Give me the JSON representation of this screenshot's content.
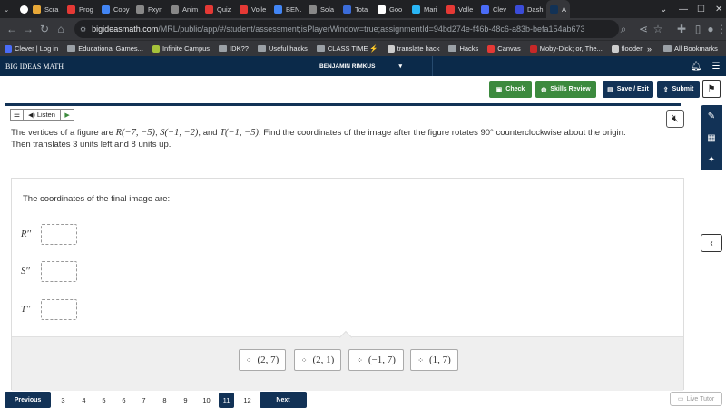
{
  "browser": {
    "tabs": [
      {
        "label": "Scra",
        "color": "#e8a838"
      },
      {
        "label": "Prog",
        "color": "#e53935"
      },
      {
        "label": "Copy",
        "color": "#4285f4"
      },
      {
        "label": "Fxyn",
        "color": "#888888"
      },
      {
        "label": "Anim",
        "color": "#888888"
      },
      {
        "label": "Quiz",
        "color": "#e53935"
      },
      {
        "label": "Volle",
        "color": "#e53935"
      },
      {
        "label": "BEN.",
        "color": "#4285f4"
      },
      {
        "label": "Sola",
        "color": "#888888"
      },
      {
        "label": "Tota",
        "color": "#3b6cd9"
      },
      {
        "label": "Goo",
        "color": "#ffffff"
      },
      {
        "label": "Mari",
        "color": "#29b6f6"
      },
      {
        "label": "Volle",
        "color": "#e53935"
      },
      {
        "label": "Clev",
        "color": "#4a6cf7"
      },
      {
        "label": "Dash",
        "color": "#3b4cd9"
      },
      {
        "label": "A",
        "color": "#123256"
      }
    ],
    "url_main": "bigideasmath.com",
    "url_rest": "/MRL/public/app/#/student/assessment;isPlayerWindow=true;assignmentId=94bd274e-f46b-48c6-a83b-befa154ab673",
    "bookmarks": [
      {
        "label": "Clever | Log in",
        "type": "site",
        "color": "#4a6cf7"
      },
      {
        "label": "Educational Games...",
        "type": "folder"
      },
      {
        "label": "Infinite Campus",
        "type": "site",
        "color": "#a5c23a"
      },
      {
        "label": "IDK??",
        "type": "folder"
      },
      {
        "label": "Useful hacks",
        "type": "folder"
      },
      {
        "label": "CLASS TIME ⚡",
        "type": "folder"
      },
      {
        "label": "translate hack",
        "type": "site",
        "color": "#cccccc"
      },
      {
        "label": "Hacks",
        "type": "folder"
      },
      {
        "label": "Canvas",
        "type": "site",
        "color": "#e53935"
      },
      {
        "label": "Moby-Dick; or, The...",
        "type": "site",
        "color": "#c62828"
      },
      {
        "label": "flooder",
        "type": "site",
        "color": "#cccccc"
      }
    ],
    "more_bookmarks": "»",
    "all_bookmarks": "All Bookmarks"
  },
  "app": {
    "name": "BIG IDEAS MATH",
    "username": "BENJAMIN RIMKUS",
    "check_label": "Check",
    "skills_review_label": "Skills Review",
    "save_exit_label": "Save / Exit",
    "submit_label": "Submit",
    "listen_label": "Listen"
  },
  "question": {
    "part1": "The vertices of a figure are ",
    "R": "R(−7, −5)",
    "sep1": ", ",
    "S": "S(−1, −2)",
    "sep2": ",  and ",
    "T": "T(−1, −5)",
    "part2": ".  Find the coordinates of the image after the figure rotates 90° counterclockwise about the origin. Then translates 3 units left and 8 units up."
  },
  "answer": {
    "prompt": "The coordinates of the final image are:",
    "labels": [
      "R′′",
      "S′′",
      "T′′"
    ]
  },
  "tiles": [
    "(2, 7)",
    "(2, 1)",
    "(−1, 7)",
    "(1, 7)"
  ],
  "pagination": {
    "previous_label": "Previous",
    "next_label": "Next",
    "pages": [
      "3",
      "4",
      "5",
      "6",
      "7",
      "8",
      "9",
      "10",
      "11",
      "12"
    ],
    "current": "11"
  },
  "live_tutor_label": "Live Tutor",
  "colors": {
    "navy": "#123256",
    "green": "#3c8a3e",
    "header": "#0b2a4a"
  }
}
